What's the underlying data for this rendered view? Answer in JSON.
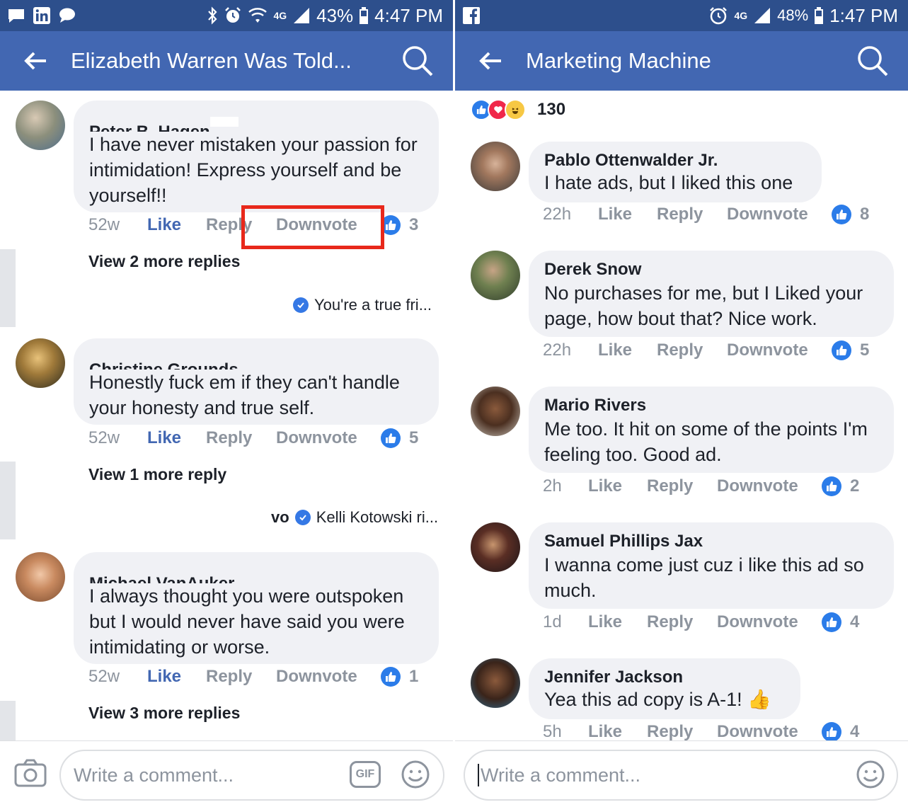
{
  "left": {
    "statusbar": {
      "network": "4G",
      "battery": "43%",
      "time": "4:47 PM"
    },
    "appbar": {
      "title": "Elizabeth Warren Was Told..."
    },
    "comments": [
      {
        "name": "Peter B. Hagen",
        "text": "I have never mistaken your passion for intimidation! Express yourself and be yourself!!",
        "time": "52w",
        "like": "Like",
        "reply": "Reply",
        "downvote": "Downvote",
        "count": "3",
        "view_more": "View 2 more replies",
        "reply_preview": "You're a true fri..."
      },
      {
        "name": "Christine Grounds",
        "text": "Honestly fuck em if they can't handle your honesty and true self.",
        "time": "52w",
        "like": "Like",
        "reply": "Reply",
        "downvote": "Downvote",
        "count": "5",
        "view_more": "View 1 more reply",
        "reply_preview_prefix": "vo",
        "reply_preview": "Kelli Kotowski ri..."
      },
      {
        "name": "Michael VanAuker",
        "text": "I always thought you were outspoken but I would never have said you were intimidating or worse.",
        "time": "52w",
        "like": "Like",
        "reply": "Reply",
        "downvote": "Downvote",
        "count": "1",
        "view_more": "View 3 more replies"
      }
    ],
    "composer": {
      "placeholder": "Write a comment...",
      "gif": "GIF"
    }
  },
  "right": {
    "statusbar": {
      "network": "4G",
      "battery": "48%",
      "time": "1:47 PM"
    },
    "appbar": {
      "title": "Marketing Machine"
    },
    "reactions_count": "130",
    "comments": [
      {
        "name": "Pablo Ottenwalder Jr.",
        "text": "I hate ads, but I liked this one",
        "time": "22h",
        "like": "Like",
        "reply": "Reply",
        "downvote": "Downvote",
        "count": "8"
      },
      {
        "name": "Derek Snow",
        "text": "No purchases for me, but I Liked your page, how bout that? Nice work.",
        "time": "22h",
        "like": "Like",
        "reply": "Reply",
        "downvote": "Downvote",
        "count": "5"
      },
      {
        "name": "Mario Rivers",
        "text": "Me too. It hit on some of the points I'm feeling too. Good ad.",
        "time": "2h",
        "like": "Like",
        "reply": "Reply",
        "downvote": "Downvote",
        "count": "2"
      },
      {
        "name": "Samuel Phillips Jax",
        "text": "I wanna come just cuz i like this ad so much.",
        "time": "1d",
        "like": "Like",
        "reply": "Reply",
        "downvote": "Downvote",
        "count": "4"
      },
      {
        "name": "Jennifer Jackson",
        "text": "Yea this ad copy is A-1! 👍",
        "time": "5h",
        "like": "Like",
        "reply": "Reply",
        "downvote": "Downvote",
        "count": "4"
      }
    ],
    "composer": {
      "placeholder": "Write a comment..."
    }
  },
  "colors": {
    "statusbar": "#2d4f8c",
    "appbar": "#4267b2",
    "bubble": "#f0f1f5",
    "like_blue": "#4267b2",
    "badge_blue": "#2b7ce9",
    "highlight_red": "#e8281b"
  },
  "icons": [
    "back-arrow-icon",
    "search-icon",
    "thumbs-up-icon",
    "check-badge-icon",
    "camera-icon",
    "gif-icon",
    "smiley-icon",
    "facebook-icon",
    "linkedin-icon",
    "message-icon",
    "bluetooth-icon",
    "alarm-icon",
    "wifi-icon",
    "signal-icon",
    "battery-icon"
  ]
}
